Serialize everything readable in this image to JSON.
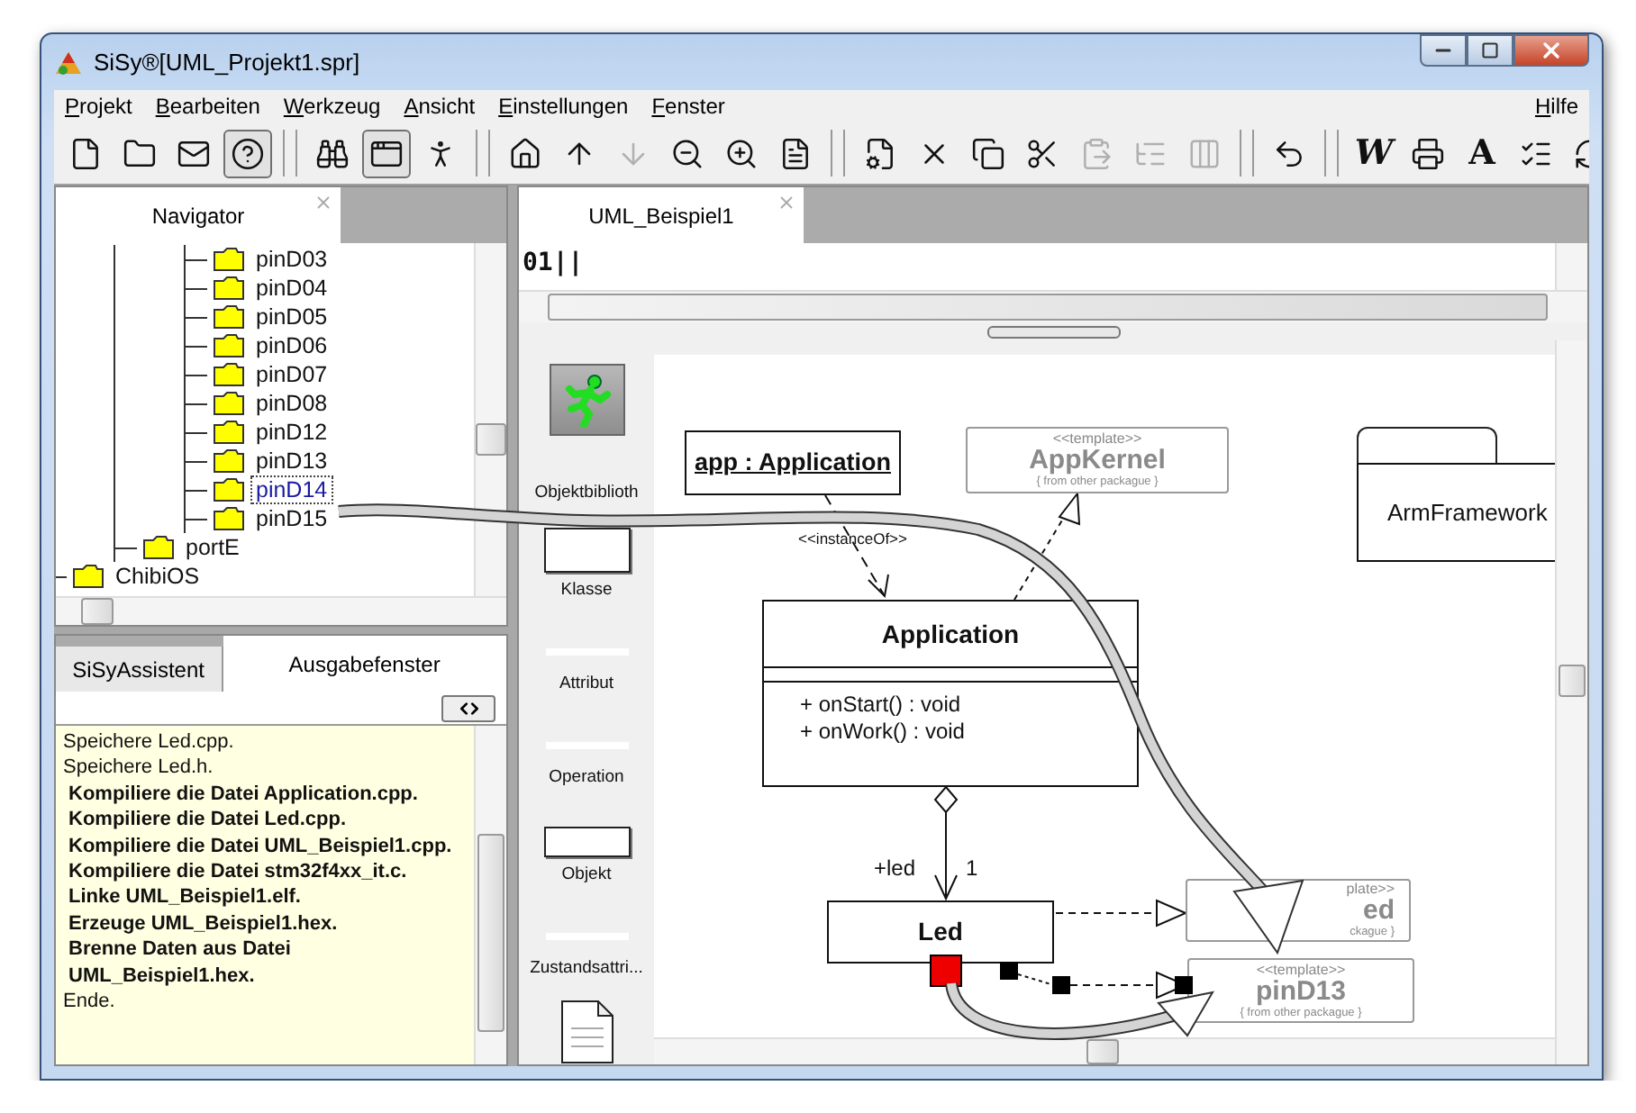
{
  "window": {
    "title": "SiSy®[UML_Projekt1.spr]"
  },
  "menu": [
    "Projekt",
    "Bearbeiten",
    "Werkzeug",
    "Ansicht",
    "Einstellungen",
    "Fenster"
  ],
  "help_menu": "Hilfe",
  "toolbar": [
    {
      "kind": "button",
      "pressed": false,
      "disabled": false
    },
    {
      "kind": "button",
      "pressed": false,
      "disabled": false
    },
    {
      "kind": "button",
      "pressed": false,
      "disabled": false
    },
    {
      "kind": "button",
      "pressed": true,
      "disabled": false
    },
    {
      "kind": "separator"
    },
    {
      "kind": "button",
      "pressed": false,
      "disabled": false
    },
    {
      "kind": "button",
      "pressed": true,
      "disabled": false
    },
    {
      "kind": "button",
      "pressed": false,
      "disabled": false
    },
    {
      "kind": "separator"
    },
    {
      "kind": "button",
      "pressed": false,
      "disabled": false
    },
    {
      "kind": "button",
      "pressed": false,
      "disabled": false
    },
    {
      "kind": "button",
      "pressed": false,
      "disabled": true
    },
    {
      "kind": "button",
      "pressed": false,
      "disabled": false
    },
    {
      "kind": "button",
      "pressed": false,
      "disabled": false
    },
    {
      "kind": "button",
      "pressed": false,
      "disabled": false
    },
    {
      "kind": "separator"
    },
    {
      "kind": "button",
      "pressed": false,
      "disabled": false
    },
    {
      "kind": "button",
      "pressed": false,
      "disabled": false
    },
    {
      "kind": "button",
      "pressed": false,
      "disabled": false
    },
    {
      "kind": "button",
      "pressed": false,
      "disabled": false
    },
    {
      "kind": "button",
      "pressed": false,
      "disabled": true
    },
    {
      "kind": "button",
      "pressed": false,
      "disabled": true
    },
    {
      "kind": "button",
      "pressed": false,
      "disabled": true
    },
    {
      "kind": "separator"
    },
    {
      "kind": "button",
      "pressed": false,
      "disabled": false
    },
    {
      "kind": "separator"
    },
    {
      "kind": "glyph",
      "text": "W",
      "pressed": false,
      "disabled": false
    },
    {
      "kind": "button",
      "pressed": false,
      "disabled": false
    },
    {
      "kind": "glyph",
      "text": "A",
      "pressed": false,
      "disabled": false
    },
    {
      "kind": "button",
      "pressed": false,
      "disabled": false
    },
    {
      "kind": "button",
      "pressed": false,
      "disabled": false
    }
  ],
  "navigator": {
    "tab": "Navigator",
    "tree": [
      {
        "children": [
          {
            "children": [
              {
                "label": "pinD03",
                "selected": false
              },
              {
                "label": "pinD04",
                "selected": false
              },
              {
                "label": "pinD05",
                "selected": false
              },
              {
                "label": "pinD06",
                "selected": false
              },
              {
                "label": "pinD07",
                "selected": false
              },
              {
                "label": "pinD08",
                "selected": false
              },
              {
                "label": "pinD12",
                "selected": false
              },
              {
                "label": "pinD13",
                "selected": false
              },
              {
                "label": "pinD14",
                "selected": true
              },
              {
                "label": "pinD15",
                "selected": false
              }
            ]
          },
          {
            "label": "portE",
            "selected": false
          }
        ]
      },
      {
        "label": "ChibiOS",
        "selected": false
      }
    ]
  },
  "output_panel": {
    "tabs": [
      {
        "label": "SiSyAssistent",
        "selected": false
      },
      {
        "label": "Ausgabefenster",
        "selected": true
      }
    ],
    "lines": [
      {
        "text": "Speichere Led.cpp.",
        "bold": false
      },
      {
        "text": "Speichere Led.h.",
        "bold": false
      },
      {
        "text": "Kompiliere die Datei Application.cpp.",
        "bold": true
      },
      {
        "text": "Kompiliere die Datei Led.cpp.",
        "bold": true
      },
      {
        "text": "Kompiliere die Datei UML_Beispiel1.cpp.",
        "bold": true
      },
      {
        "text": "Kompiliere die Datei stm32f4xx_it.c.",
        "bold": true
      },
      {
        "text": "Linke UML_Beispiel1.elf.",
        "bold": true
      },
      {
        "text": "Erzeuge UML_Beispiel1.hex.",
        "bold": true
      },
      {
        "text": "Brenne Daten aus Datei UML_Beispiel1.hex.",
        "bold": true
      },
      {
        "text": "Ende.",
        "bold": false
      }
    ]
  },
  "editor": {
    "tab": "UML_Beispiel1",
    "code": "01||"
  },
  "toolbox": [
    {
      "kind": "runner",
      "label": "Objektbiblioth"
    },
    {
      "kind": "box",
      "label": "Klasse"
    },
    {
      "kind": "line",
      "label": "Attribut"
    },
    {
      "kind": "line",
      "label": "Operation"
    },
    {
      "kind": "small_box",
      "label": "Objekt"
    },
    {
      "kind": "line",
      "label": "Zustandsattri..."
    },
    {
      "kind": "document"
    }
  ],
  "diagram": {
    "elements": [
      {
        "kind": "object",
        "name": "app : Application"
      },
      {
        "kind": "template",
        "stereotype": "<<template>>",
        "name": "AppKernel",
        "note": "{ from other packague }"
      },
      {
        "kind": "package",
        "name": "ArmFramework"
      },
      {
        "kind": "class",
        "name": "Application",
        "operations": [
          "+ onStart() : void",
          "+ onWork() : void"
        ]
      },
      {
        "kind": "class",
        "name": "Led"
      },
      {
        "kind": "template",
        "stereotype": "plate>>",
        "name": "ed",
        "note": "ckague }"
      },
      {
        "kind": "template",
        "stereotype": "<<template>>",
        "name": "pinD13",
        "note": "{ from other packague }"
      }
    ],
    "labels": [
      "<<instanceOf>>",
      "+led",
      "1"
    ],
    "ports": [
      {
        "selected": true
      },
      {
        "selected": false
      },
      {
        "selected": false
      },
      {
        "selected": false
      }
    ]
  }
}
